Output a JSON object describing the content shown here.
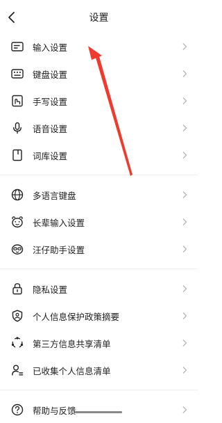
{
  "header": {
    "title": "设置"
  },
  "groups": [
    [
      {
        "label": "输入设置",
        "icon": "keyboard-input-icon"
      },
      {
        "label": "键盘设置",
        "icon": "keyboard-icon"
      },
      {
        "label": "手写设置",
        "icon": "handwriting-icon"
      },
      {
        "label": "语音设置",
        "icon": "microphone-icon"
      },
      {
        "label": "词库设置",
        "icon": "dictionary-icon"
      }
    ],
    [
      {
        "label": "多语言键盘",
        "icon": "globe-icon"
      },
      {
        "label": "长辈输入设置",
        "icon": "elder-face-icon"
      },
      {
        "label": "汪仔助手设置",
        "icon": "assistant-icon"
      }
    ],
    [
      {
        "label": "隐私设置",
        "icon": "lock-icon"
      },
      {
        "label": "个人信息保护政策摘要",
        "icon": "shield-user-icon"
      },
      {
        "label": "第三方信息共享清单",
        "icon": "share-circle-icon"
      },
      {
        "label": "已收集个人信息清单",
        "icon": "user-list-icon"
      }
    ],
    [
      {
        "label": "帮助与反馈",
        "icon": "help-icon"
      }
    ]
  ],
  "annotation": {
    "color": "#f03a2e"
  },
  "colors": {
    "chevron": "#b5b5b5",
    "divider": "#eeeeee"
  }
}
